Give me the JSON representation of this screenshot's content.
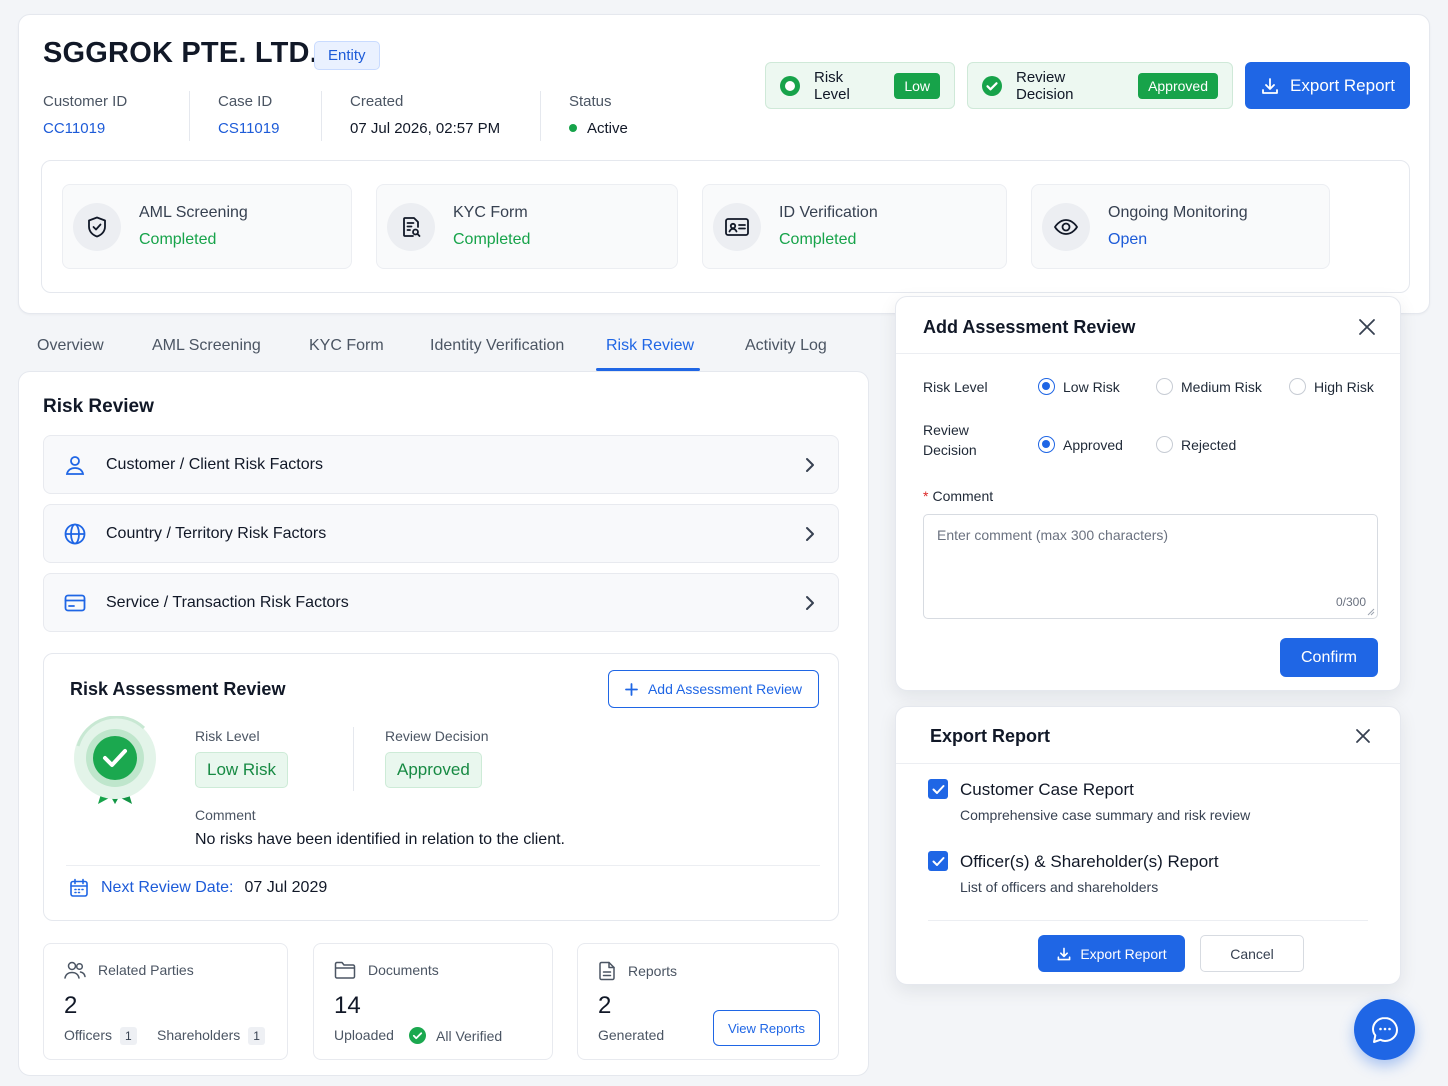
{
  "header": {
    "company_name": "SGGROK PTE. LTD.",
    "entity_badge": "Entity",
    "customer_id_label": "Customer ID",
    "customer_id": "CC11019",
    "case_id_label": "Case ID",
    "case_id": "CS11019",
    "created_label": "Created",
    "created": "07 Jul 2026, 02:57 PM",
    "status_label": "Status",
    "status": "Active",
    "risk_level_label": "Risk Level",
    "risk_level": "Low",
    "review_decision_label": "Review Decision",
    "review_decision": "Approved",
    "export_button": "Export Report"
  },
  "steps": [
    {
      "title": "AML Screening",
      "status": "Completed",
      "icon": "shield-check-icon"
    },
    {
      "title": "KYC Form",
      "status": "Completed",
      "icon": "form-search-icon"
    },
    {
      "title": "ID Verification",
      "status": "Completed",
      "icon": "id-card-icon"
    },
    {
      "title": "Ongoing Monitoring",
      "status": "Open",
      "icon": "eye-icon"
    }
  ],
  "tabs": [
    "Overview",
    "AML Screening",
    "KYC Form",
    "Identity Verification",
    "Risk Review",
    "Activity Log"
  ],
  "active_tab": "Risk Review",
  "risk_review": {
    "title": "Risk Review",
    "factors": [
      {
        "label": "Customer / Client Risk Factors",
        "icon": "user-icon"
      },
      {
        "label": "Country / Territory Risk Factors",
        "icon": "globe-icon"
      },
      {
        "label": "Service / Transaction Risk Factors",
        "icon": "credit-card-icon"
      }
    ],
    "assessment": {
      "title": "Risk Assessment Review",
      "add_button": "Add Assessment Review",
      "risk_level_label": "Risk Level",
      "risk_level": "Low Risk",
      "decision_label": "Review Decision",
      "decision": "Approved",
      "comment_label": "Comment",
      "comment": "No risks have been identified in relation to the client.",
      "next_review_label": "Next Review Date:",
      "next_review": "07 Jul 2029"
    }
  },
  "stats": {
    "parties": {
      "label": "Related Parties",
      "count": "2",
      "officers_label": "Officers",
      "officers": "1",
      "shareholders_label": "Shareholders",
      "shareholders": "1"
    },
    "documents": {
      "label": "Documents",
      "count": "14",
      "uploaded": "Uploaded",
      "verified": "All Verified"
    },
    "reports": {
      "label": "Reports",
      "count": "2",
      "generated": "Generated",
      "view_button": "View Reports"
    }
  },
  "add_review_modal": {
    "title": "Add Assessment Review",
    "risk_level_label": "Risk Level",
    "risk_options": [
      "Low Risk",
      "Medium Risk",
      "High Risk"
    ],
    "selected_risk": "Low Risk",
    "decision_label_1": "Review",
    "decision_label_2": "Decision",
    "decision_options": [
      "Approved",
      "Rejected"
    ],
    "selected_decision": "Approved",
    "required_mark": "*",
    "comment_label": "Comment",
    "comment_placeholder": "Enter comment (max 300 characters)",
    "char_count": "0/300",
    "confirm_button": "Confirm"
  },
  "export_modal": {
    "title": "Export Report",
    "options": [
      {
        "title": "Customer Case Report",
        "desc": "Comprehensive case summary and risk review",
        "checked": true
      },
      {
        "title": "Officer(s) & Shareholder(s) Report",
        "desc": "List of officers and shareholders",
        "checked": true
      }
    ],
    "export_button": "Export Report",
    "cancel_button": "Cancel"
  },
  "colors": {
    "primary": "#1f66e5",
    "success": "#17a34a",
    "link": "#1d5bd8"
  }
}
